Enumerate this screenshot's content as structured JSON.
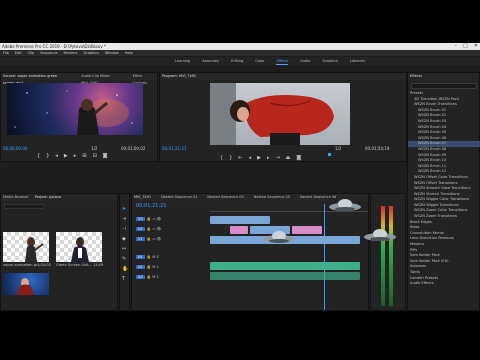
{
  "app": {
    "title": "Adobe Premiere Pro CC 2019 - D:\\Pytovo\\Dz\\Kosov *",
    "menus": [
      "File",
      "Edit",
      "Clip",
      "Sequence",
      "Markers",
      "Graphics",
      "Window",
      "Help"
    ]
  },
  "workspaces": [
    "Learning",
    "Assembly",
    "Editing",
    "Color",
    "Effects",
    "Audio",
    "Graphics",
    "Libraries"
  ],
  "active_workspace": "Effects",
  "source_monitor": {
    "tabs": [
      "Source: vapor animation green screen.mp4",
      "Audio Clip Mixer: MVI_7491",
      "Effect Controls"
    ],
    "timecode_left": "00;00;00;00",
    "fit": "1/2",
    "timecode_right": "00;01;00;02"
  },
  "program_monitor": {
    "tab": "Program: MVI_7491",
    "timecode_left": "00;01;21;21",
    "fit": "1/2",
    "timecode_right": "00;01;54;19"
  },
  "effects_panel": {
    "title": "Effects",
    "search": "",
    "items": [
      {
        "label": "Presets",
        "indent": 0,
        "selected": false
      },
      {
        "label": "3D Transition WSZN Pack",
        "indent": 1,
        "selected": false
      },
      {
        "label": "WSZN Brush Transitions",
        "indent": 1,
        "selected": false
      },
      {
        "label": "WSZN Brush 01",
        "indent": 2,
        "selected": false
      },
      {
        "label": "WSZN Brush 02",
        "indent": 2,
        "selected": false
      },
      {
        "label": "WSZN Brush 03",
        "indent": 2,
        "selected": false
      },
      {
        "label": "WSZN Brush 04",
        "indent": 2,
        "selected": false
      },
      {
        "label": "WSZN Brush 05",
        "indent": 2,
        "selected": false
      },
      {
        "label": "WSZN Brush 06",
        "indent": 2,
        "selected": false
      },
      {
        "label": "WSZN Brush 07",
        "indent": 2,
        "selected": true
      },
      {
        "label": "WSZN Brush 08",
        "indent": 2,
        "selected": false
      },
      {
        "label": "WSZN Brush 09",
        "indent": 2,
        "selected": false
      },
      {
        "label": "WSZN Brush 10",
        "indent": 2,
        "selected": false
      },
      {
        "label": "WSZN Brush 11",
        "indent": 2,
        "selected": false
      },
      {
        "label": "WSZN Brush 12",
        "indent": 2,
        "selected": false
      },
      {
        "label": "WSZN Offset Color Transitions",
        "indent": 1,
        "selected": false
      },
      {
        "label": "WSZN Offset Transitions",
        "indent": 1,
        "selected": false
      },
      {
        "label": "WSZN Smooth Glow Transitions",
        "indent": 1,
        "selected": false
      },
      {
        "label": "WSZN Stretch Transitions",
        "indent": 1,
        "selected": false
      },
      {
        "label": "WSZN Wiggle Color Transitions",
        "indent": 1,
        "selected": false
      },
      {
        "label": "WSZN Wiggle Transitions",
        "indent": 1,
        "selected": false
      },
      {
        "label": "WSZN Zoom Color Transitions",
        "indent": 1,
        "selected": false
      },
      {
        "label": "WSZN Zoom Transitions",
        "indent": 1,
        "selected": false
      },
      {
        "label": "Black Edges",
        "indent": 0,
        "selected": false
      },
      {
        "label": "Bless",
        "indent": 0,
        "selected": false
      },
      {
        "label": "Convolution Kernel",
        "indent": 0,
        "selected": false
      },
      {
        "label": "Lens Distortion Removal",
        "indent": 0,
        "selected": false
      },
      {
        "label": "Mosaics",
        "indent": 0,
        "selected": false
      },
      {
        "label": "PiPs",
        "indent": 0,
        "selected": false
      },
      {
        "label": "Sam Kolder Pack",
        "indent": 0,
        "selected": false
      },
      {
        "label": "Sam Kolder Pack (EX)",
        "indent": 0,
        "selected": false
      },
      {
        "label": "Solarizes",
        "indent": 0,
        "selected": false
      },
      {
        "label": "Twirls",
        "indent": 0,
        "selected": false
      },
      {
        "label": "Lumetri Presets",
        "indent": 0,
        "selected": false
      },
      {
        "label": "Audio Effects",
        "indent": 0,
        "selected": false
      }
    ]
  },
  "project_panel": {
    "tabs": [
      "Media Browser",
      "Project: pytovo"
    ],
    "items": [
      {
        "name": "vapor animation gr...",
        "duration": "1;00;02"
      },
      {
        "name": "Green Screen Suit...",
        "duration": "13;09"
      },
      {
        "name": "",
        "duration": ""
      }
    ]
  },
  "timeline": {
    "tabs": [
      "MVI_7491",
      "Nested Sequence 01",
      "Nested Sequence 05",
      "Nested Sequence 05",
      "Nested Sequence 06"
    ],
    "timecode": "00;01;21;21",
    "tracks": [
      "V3",
      "V2",
      "V1",
      "A1",
      "A2",
      "A3"
    ]
  },
  "colors": {
    "accent": "#3d9bff",
    "clip_video": "#7aa7d8",
    "clip_audio": "#3fae8a",
    "clip_pink": "#d88bc7"
  }
}
